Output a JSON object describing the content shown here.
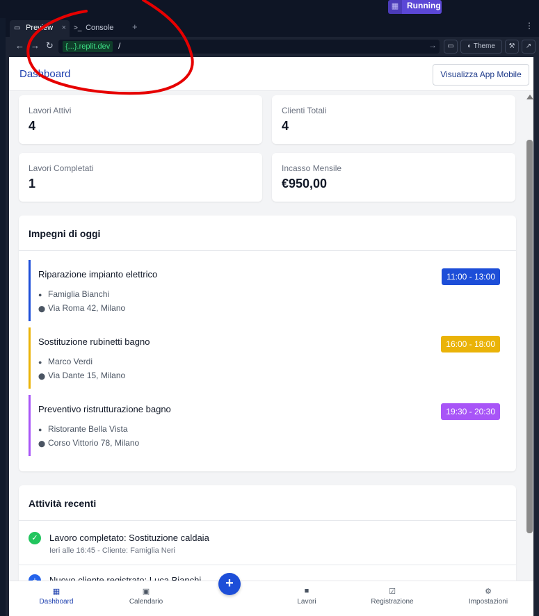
{
  "workspace": {
    "run_status": "Running"
  },
  "tabs": [
    {
      "label": "Preview",
      "close": "×"
    },
    {
      "label": "Console"
    }
  ],
  "tab_add": "+",
  "tab_more": "⋮",
  "browser": {
    "host": "{...}.replit.dev",
    "path": "/",
    "theme_label": "Theme"
  },
  "app": {
    "title": "Dashboard",
    "mobile_button": "Visualizza App Mobile"
  },
  "stats": [
    {
      "label": "Lavori Attivi",
      "value": "4"
    },
    {
      "label": "Clienti Totali",
      "value": "4"
    },
    {
      "label": "Lavori Completati",
      "value": "1"
    },
    {
      "label": "Incasso Mensile",
      "value": "€950,00"
    }
  ],
  "today": {
    "title": "Impegni di oggi",
    "appointments": [
      {
        "title": "Riparazione impianto elettrico",
        "client": "Famiglia Bianchi",
        "address": "Via Roma 42, Milano",
        "time": "11:00 - 13:00",
        "color": "#1d4ed8"
      },
      {
        "title": "Sostituzione rubinetti bagno",
        "client": "Marco Verdi",
        "address": "Via Dante 15, Milano",
        "time": "16:00 - 18:00",
        "color": "#eab308"
      },
      {
        "title": "Preventivo ristrutturazione bagno",
        "client": "Ristorante Bella Vista",
        "address": "Corso Vittorio 78, Milano",
        "time": "19:30 - 20:30",
        "color": "#a855f7"
      }
    ]
  },
  "recent": {
    "title": "Attività recenti",
    "items": [
      {
        "title": "Lavoro completato: Sostituzione caldaia",
        "meta": "Ieri alle 16:45 - Cliente: Famiglia Neri"
      },
      {
        "title": "Nuovo cliente registrato: Luca Bianchi",
        "meta": ""
      }
    ]
  },
  "bottom_nav": [
    {
      "label": "Dashboard",
      "icon": "grid-icon"
    },
    {
      "label": "Calendario",
      "icon": "calendar-icon"
    },
    {
      "label": "Lavori",
      "icon": "briefcase-icon"
    },
    {
      "label": "Registrazione",
      "icon": "clipboard-check-icon"
    },
    {
      "label": "Impostazioni",
      "icon": "gear-icon"
    }
  ],
  "fab_label": "+",
  "colors": {
    "accent": "#1d4ed8",
    "brand_text": "#1e40af",
    "annotation": "#e60000",
    "success": "#22c55e"
  }
}
